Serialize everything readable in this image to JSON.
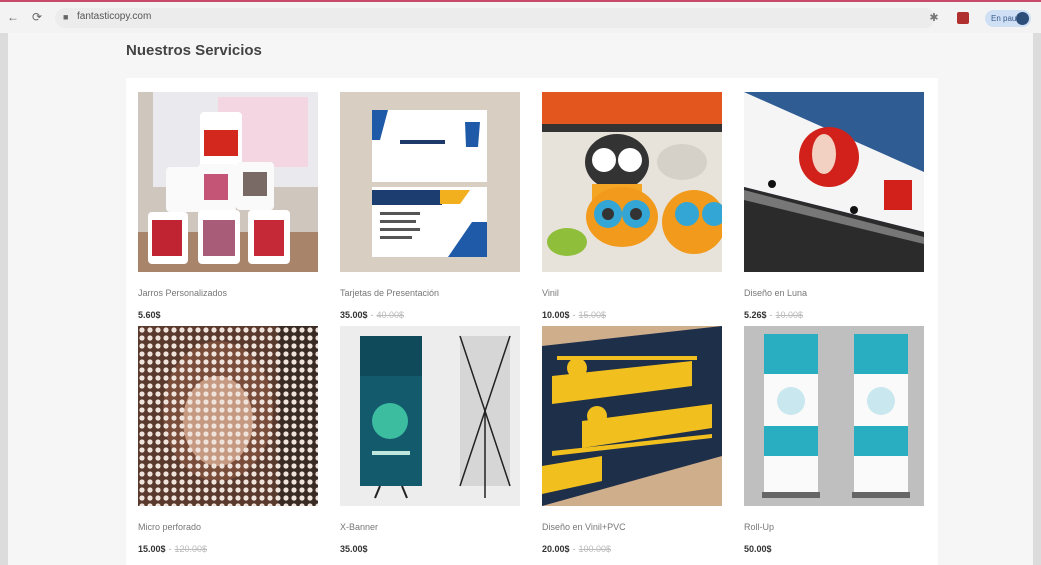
{
  "browser": {
    "back": "←",
    "reload": "⟳",
    "url": "fantasticopy.com",
    "profile": "En pausa"
  },
  "page": {
    "title": "Nuestros Servicios"
  },
  "products": [
    {
      "name": "Jarros Personalizados",
      "price": "5.60$",
      "old_price": ""
    },
    {
      "name": "Tarjetas de Presentación",
      "price": "35.00$",
      "old_price": "40.00$"
    },
    {
      "name": "Vinil",
      "price": "10.00$",
      "old_price": "15.00$"
    },
    {
      "name": "Diseño en Luna",
      "price": "5.26$",
      "old_price": "10.00$"
    },
    {
      "name": "Micro perforado",
      "price": "15.00$",
      "old_price": "120.00$"
    },
    {
      "name": "X-Banner",
      "price": "35.00$",
      "old_price": ""
    },
    {
      "name": "Diseño en Vinil+PVC",
      "price": "20.00$",
      "old_price": "100.00$"
    },
    {
      "name": "Roll-Up",
      "price": "50.00$",
      "old_price": ""
    }
  ]
}
